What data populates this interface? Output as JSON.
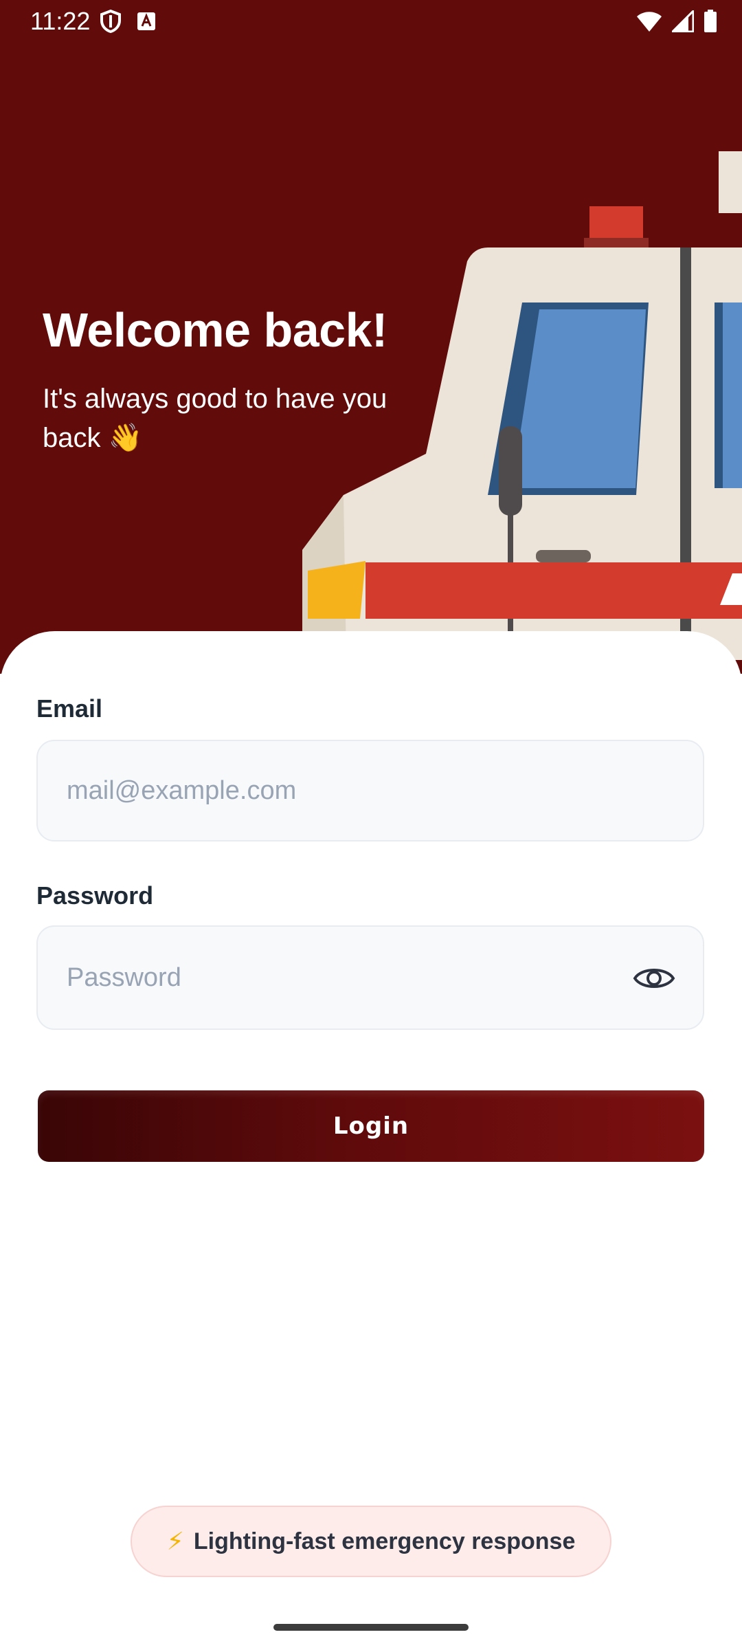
{
  "status_bar": {
    "time": "11:22",
    "left_icons": [
      "shield-icon",
      "a-badge-icon"
    ],
    "right_icons": [
      "wifi-icon",
      "signal-icon",
      "battery-icon"
    ]
  },
  "hero": {
    "title": "Welcome back!",
    "subtitle": "It's always good to have you back 👋",
    "background_color": "#620b0b"
  },
  "form": {
    "email": {
      "label": "Email",
      "placeholder": "mail@example.com",
      "value": ""
    },
    "password": {
      "label": "Password",
      "placeholder": "Password",
      "value": "",
      "toggle_icon": "eye-icon"
    },
    "login_label": "Login"
  },
  "feature": {
    "icon": "⚡",
    "text": "Lighting-fast emergency response"
  },
  "colors": {
    "brand_dark_red": "#620b0b",
    "button_gradient_start": "#3a0506",
    "button_gradient_end": "#7b1010",
    "pill_background": "#fdecea"
  }
}
